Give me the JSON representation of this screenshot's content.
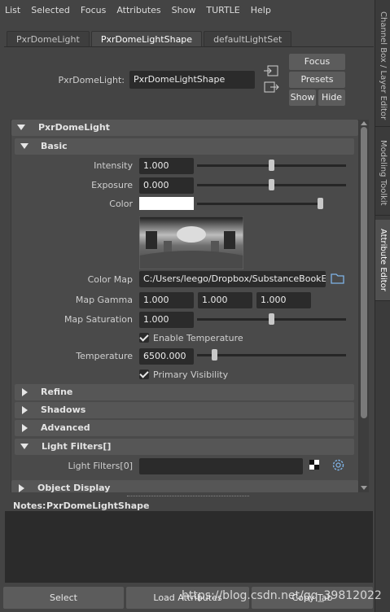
{
  "menu": [
    "List",
    "Selected",
    "Focus",
    "Attributes",
    "Show",
    "TURTLE",
    "Help"
  ],
  "side_tabs": [
    "Channel Box / Layer Editor",
    "Modeling Toolkit",
    "Attribute Editor"
  ],
  "tabs": [
    "PxrDomeLight",
    "PxrDomeLightShape",
    "defaultLightSet"
  ],
  "node": {
    "label": "PxrDomeLight:",
    "value": "PxrDomeLightShape"
  },
  "buttons": {
    "focus": "Focus",
    "presets": "Presets",
    "show": "Show",
    "hide": "Hide"
  },
  "sections": {
    "main": "PxrDomeLight",
    "basic": "Basic",
    "refine": "Refine",
    "shadows": "Shadows",
    "advanced": "Advanced",
    "light_filters": "Light Filters[]",
    "object_display": "Object Display"
  },
  "attrs": {
    "intensity": {
      "label": "Intensity",
      "value": "1.000",
      "slider": 0.5
    },
    "exposure": {
      "label": "Exposure",
      "value": "0.000",
      "slider": 0.5
    },
    "color": {
      "label": "Color",
      "swatch": "#ffffff",
      "slider": 1.0
    },
    "color_map": {
      "label": "Color Map",
      "value": "C:/Users/leego/Dropbox/SubstanceBookExa"
    },
    "map_gamma": {
      "label": "Map Gamma",
      "values": [
        "1.000",
        "1.000",
        "1.000"
      ]
    },
    "map_saturation": {
      "label": "Map Saturation",
      "value": "1.000",
      "slider": 0.5
    },
    "enable_temperature": {
      "label": "Enable Temperature",
      "checked": true
    },
    "temperature": {
      "label": "Temperature",
      "value": "6500.000",
      "slider": 0.12
    },
    "primary_visibility": {
      "label": "Primary Visibility",
      "checked": true
    },
    "light_filter0": {
      "label": "Light Filters[0]",
      "value": ""
    }
  },
  "notes": {
    "label": "Notes:",
    "node": "PxrDomeLightShape"
  },
  "bottom_buttons": [
    "Select",
    "Load Attributes",
    "Copy Tab"
  ],
  "watermark": "https://blog.csdn.net/qq_39812022"
}
